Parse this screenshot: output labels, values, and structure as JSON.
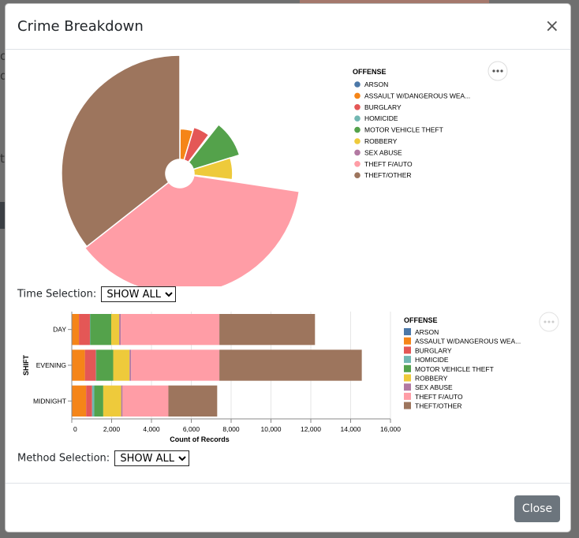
{
  "background": {
    "letters": [
      "o",
      "d",
      "t"
    ]
  },
  "modal": {
    "title": "Crime Breakdown",
    "close_icon": "close-icon",
    "close_button_label": "Close"
  },
  "time_selection": {
    "label": "Time Selection:",
    "value": "SHOW ALL"
  },
  "method_selection": {
    "label": "Method Selection:",
    "value": "SHOW ALL"
  },
  "legend": {
    "title": "OFFENSE",
    "items": [
      {
        "label": "ARSON",
        "color": "#4c78a8"
      },
      {
        "label": "ASSAULT W/DANGEROUS WEA...",
        "color": "#f58518"
      },
      {
        "label": "BURGLARY",
        "color": "#e45756"
      },
      {
        "label": "HOMICIDE",
        "color": "#72b7b2"
      },
      {
        "label": "MOTOR VEHICLE THEFT",
        "color": "#54a24b"
      },
      {
        "label": "ROBBERY",
        "color": "#eeca3b"
      },
      {
        "label": "SEX ABUSE",
        "color": "#b279a2"
      },
      {
        "label": "THEFT F/AUTO",
        "color": "#ff9da6"
      },
      {
        "label": "THEFT/OTHER",
        "color": "#9d755d"
      }
    ]
  },
  "chart_data": [
    {
      "type": "pie",
      "variant": "radial",
      "categories": [
        "ARSON",
        "ASSAULT W/DANGEROUS WEA...",
        "BURGLARY",
        "HOMICIDE",
        "MOTOR VEHICLE THEFT",
        "ROBBERY",
        "SEX ABUSE",
        "THEFT F/AUTO",
        "THEFT/OTHER"
      ],
      "values": [
        30,
        1600,
        1900,
        150,
        3300,
        2300,
        180,
        12800,
        12300
      ],
      "legend_position": "right"
    },
    {
      "type": "bar",
      "orientation": "horizontal",
      "stacked": true,
      "categories": [
        "DAY",
        "EVENING",
        "MIDNIGHT"
      ],
      "xlabel": "Count of Records",
      "ylabel": "SHIFT",
      "xlim": [
        0,
        16000
      ],
      "xticks": [
        0,
        2000,
        4000,
        6000,
        8000,
        10000,
        12000,
        14000,
        16000
      ],
      "xtick_labels": [
        "0",
        "2,000",
        "4,000",
        "6,000",
        "8,000",
        "10,000",
        "12,000",
        "14,000",
        "16,000"
      ],
      "grid": true,
      "legend_position": "right",
      "series": [
        {
          "name": "ARSON",
          "values": [
            10,
            10,
            20
          ]
        },
        {
          "name": "ASSAULT W/DANGEROUS WEA...",
          "values": [
            350,
            650,
            700
          ]
        },
        {
          "name": "BURGLARY",
          "values": [
            550,
            550,
            300
          ]
        },
        {
          "name": "HOMICIDE",
          "values": [
            20,
            20,
            110
          ]
        },
        {
          "name": "MOTOR VEHICLE THEFT",
          "values": [
            1050,
            850,
            450
          ]
        },
        {
          "name": "ROBBERY",
          "values": [
            400,
            820,
            900
          ]
        },
        {
          "name": "SEX ABUSE",
          "values": [
            80,
            80,
            70
          ]
        },
        {
          "name": "THEFT F/AUTO",
          "values": [
            4950,
            4430,
            2300
          ]
        },
        {
          "name": "THEFT/OTHER",
          "values": [
            4800,
            7150,
            2450
          ]
        }
      ]
    }
  ]
}
